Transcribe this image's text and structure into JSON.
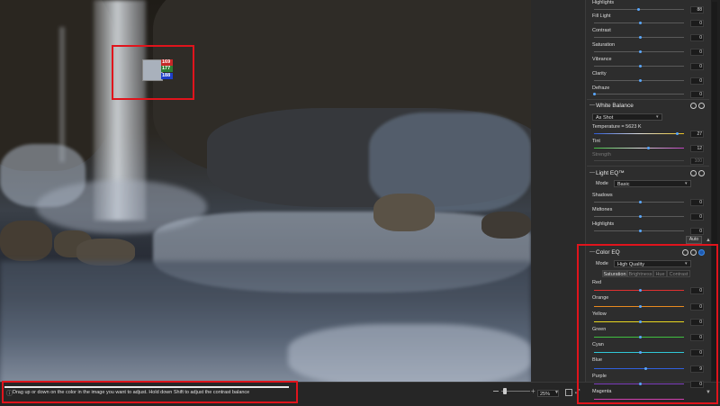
{
  "picker": {
    "r": "169",
    "g": "177",
    "b": "188",
    "swatch_color": "#a9b1bc"
  },
  "status": {
    "hint": "Drag up or down on the color in the image you want to adjust.  Hold down Shift to adjust the contrast balance",
    "zoom": "25%"
  },
  "tone": {
    "sliders": [
      {
        "label": "Highlights",
        "value": "88"
      },
      {
        "label": "Fill Light",
        "value": "0"
      },
      {
        "label": "Contrast",
        "value": "0"
      },
      {
        "label": "Saturation",
        "value": "0"
      },
      {
        "label": "Vibrance",
        "value": "0"
      },
      {
        "label": "Clarity",
        "value": "0"
      },
      {
        "label": "Defraze",
        "value": "0"
      }
    ]
  },
  "white_balance": {
    "title": "White Balance",
    "preset": "As Shot",
    "temperature_label": "Temperature = 5623 K",
    "temperature_value": "27",
    "tint_label": "Tint",
    "tint_value": "12",
    "strength_label": "Strength",
    "strength_value": "100"
  },
  "light_eq": {
    "title": "Light EQ™",
    "mode_label": "Mode",
    "mode_value": "Basic",
    "sliders": [
      {
        "label": "Shadows",
        "value": "0"
      },
      {
        "label": "Midtones",
        "value": "0"
      },
      {
        "label": "Highlights",
        "value": "0"
      }
    ],
    "auto_label": "Auto"
  },
  "color_eq": {
    "title": "Color EQ",
    "mode_label": "Mode",
    "mode_value": "High Quality",
    "tabs": [
      "Saturation",
      "Brightness",
      "Hue",
      "Contrast"
    ],
    "active_tab": "Saturation",
    "sliders": [
      {
        "label": "Red",
        "value": "0",
        "color": "#e03030"
      },
      {
        "label": "Orange",
        "value": "0",
        "color": "#e88a20"
      },
      {
        "label": "Yellow",
        "value": "0",
        "color": "#e8d820"
      },
      {
        "label": "Green",
        "value": "0",
        "color": "#40c040"
      },
      {
        "label": "Cyan",
        "value": "0",
        "color": "#30c8d8"
      },
      {
        "label": "Blue",
        "value": "9",
        "color": "#3060e0"
      },
      {
        "label": "Purple",
        "value": "0",
        "color": "#8040c0"
      },
      {
        "label": "Magenta",
        "value": "",
        "color": "#d040b0"
      }
    ]
  }
}
